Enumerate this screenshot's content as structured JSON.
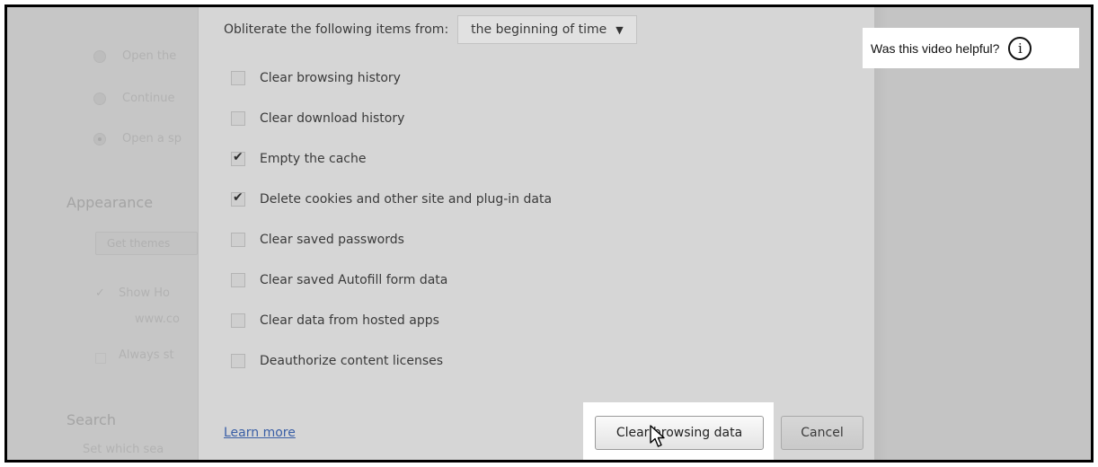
{
  "background": {
    "items": [
      "Open the",
      "Continue",
      "Open a sp",
      "Get themes",
      "Show Ho",
      "www.co",
      "Always st",
      "Set which sea"
    ],
    "appearance_heading": "Appearance",
    "search_heading": "Search"
  },
  "dialog": {
    "obliterate_label": "Obliterate the following items from:",
    "time_range_selected": "the beginning of time",
    "options": [
      {
        "label": "Clear browsing history",
        "checked": false
      },
      {
        "label": "Clear download history",
        "checked": false
      },
      {
        "label": "Empty the cache",
        "checked": true
      },
      {
        "label": "Delete cookies and other site and plug-in data",
        "checked": true
      },
      {
        "label": "Clear saved passwords",
        "checked": false
      },
      {
        "label": "Clear saved Autofill form data",
        "checked": false
      },
      {
        "label": "Clear data from hosted apps",
        "checked": false
      },
      {
        "label": "Deauthorize content licenses",
        "checked": false
      }
    ],
    "learn_more": "Learn more",
    "clear_button": "Clear browsing data",
    "cancel_button": "Cancel"
  },
  "overlay": {
    "helpful_text": "Was this video helpful?",
    "info_icon": "info-icon",
    "info_glyph": "i"
  },
  "colors": {
    "link": "#3a5fa6",
    "dialog_bg": "#d6d6d6",
    "overlay_bg": "#c9c9c9"
  }
}
